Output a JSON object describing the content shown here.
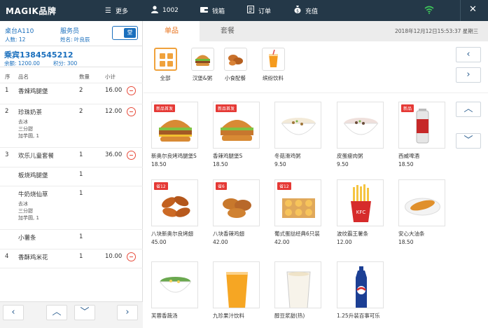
{
  "topbar": {
    "logo": "MAGIK品牌",
    "more": "更多",
    "user": "1002",
    "wallet": "钱箱",
    "orders": "订单",
    "recharge": "充值",
    "close": "✕"
  },
  "table_info": {
    "table": "桌台A110",
    "people": "人数: 12",
    "waiter": "服务员",
    "waiter_name": "姓名: 叶良辰",
    "toggle_label": "堂"
  },
  "member": {
    "name": "乘宾1384545212",
    "balance": "余额: 1200.00",
    "points": "积分: 300"
  },
  "order_headers": {
    "seq": "序",
    "name": "品名",
    "qty": "数量",
    "subtotal": "小计"
  },
  "order_rows": [
    {
      "seq": "1",
      "name": "香辣鸡腿堡",
      "qty": "2",
      "subtotal": "16.00",
      "options": []
    },
    {
      "seq": "2",
      "name": "珍珠奶茶",
      "qty": "2",
      "subtotal": "12.00",
      "options": [
        "去冰",
        "三分甜",
        "加芋圆, 1"
      ]
    },
    {
      "seq": "3",
      "name": "欢乐儿童套餐",
      "qty": "1",
      "subtotal": "36.00",
      "options": []
    },
    {
      "seq": "",
      "name": "板烧鸡腿堡",
      "qty": "1",
      "subtotal": "",
      "options": []
    },
    {
      "seq": "",
      "name": "牛奶烧仙草",
      "qty": "1",
      "subtotal": "",
      "options": [
        "去冰",
        "三分甜",
        "加芋圆, 1"
      ]
    },
    {
      "seq": "",
      "name": "小薯条",
      "qty": "1",
      "subtotal": "",
      "options": []
    },
    {
      "seq": "4",
      "name": "香酥鸡米花",
      "qty": "1",
      "subtotal": "10.00",
      "options": []
    }
  ],
  "tabs": {
    "single": "单品",
    "combo": "套餐"
  },
  "datetime": "2018年12月12日15:53:37  星期三",
  "categories": [
    {
      "label": "全部"
    },
    {
      "label": "汉堡&粥"
    },
    {
      "label": "小食配餐"
    },
    {
      "label": "缤纷饮料"
    }
  ],
  "products": [
    {
      "name": "新奥尔良烤鸡腿堡S",
      "price": "18.50",
      "badge": "新品首发"
    },
    {
      "name": "香辣鸡腿堡S",
      "price": "18.50",
      "badge": "新品首发"
    },
    {
      "name": "冬菇滑鸡粥",
      "price": "9.50",
      "badge": ""
    },
    {
      "name": "皮蛋瘦肉粥",
      "price": "9.50",
      "badge": ""
    },
    {
      "name": "西威啤酒",
      "price": "18.50",
      "badge": "新品"
    },
    {
      "name": "八块新奥尔良烤翅",
      "price": "45.00",
      "badge": "省12"
    },
    {
      "name": "八块香辣鸡翅",
      "price": "42.00",
      "badge": "省6"
    },
    {
      "name": "葡式蛋挞经典6只装",
      "price": "42.00",
      "badge": "省12"
    },
    {
      "name": "波纹霸王薯条",
      "price": "12.00",
      "badge": ""
    },
    {
      "name": "安心大油条",
      "price": "18.50",
      "badge": ""
    },
    {
      "name": "芙蓉香蔬汤",
      "price": "",
      "badge": ""
    },
    {
      "name": "九珍果汁饮料",
      "price": "",
      "badge": ""
    },
    {
      "name": "醇豆浆甜(热)",
      "price": "",
      "badge": ""
    },
    {
      "name": "1.25升装百事可乐",
      "price": "",
      "badge": ""
    }
  ],
  "colors": {
    "topbar": "#243848",
    "accent": "#e8731d",
    "blue": "#1a6fbd",
    "danger": "#e53935"
  }
}
